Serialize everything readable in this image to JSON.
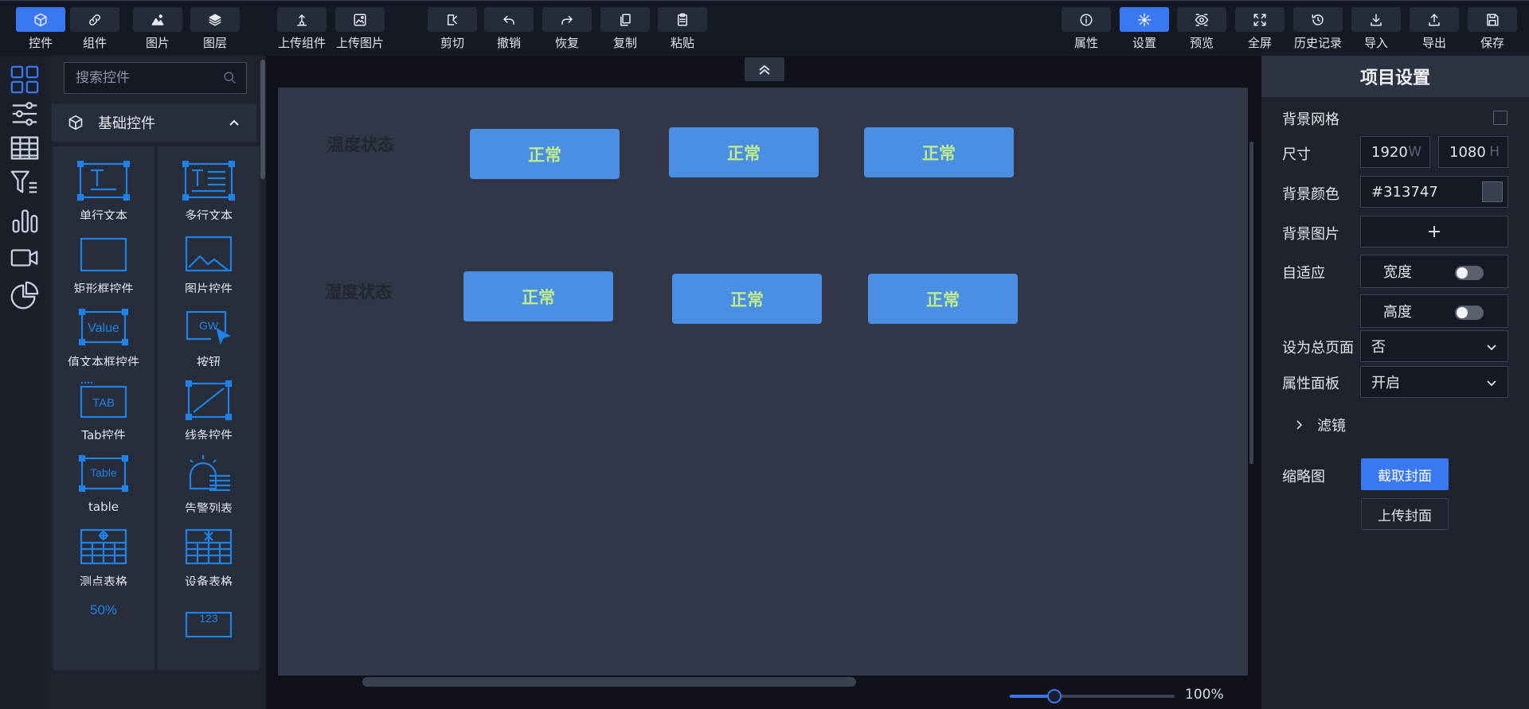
{
  "toolbar": {
    "left": [
      {
        "label": "控件",
        "icon": "cube-icon",
        "active": true
      },
      {
        "label": "组件",
        "icon": "link-icon"
      },
      {
        "label": "图片",
        "icon": "image-icon"
      },
      {
        "label": "图层",
        "icon": "layers-icon"
      }
    ],
    "upload": [
      {
        "label": "上传组件",
        "icon": "upload-component-icon"
      },
      {
        "label": "上传图片",
        "icon": "upload-image-icon"
      }
    ],
    "edit": [
      {
        "label": "剪切",
        "icon": "cut-icon"
      },
      {
        "label": "撤销",
        "icon": "undo-icon"
      },
      {
        "label": "恢复",
        "icon": "redo-icon"
      },
      {
        "label": "复制",
        "icon": "copy-icon"
      },
      {
        "label": "粘贴",
        "icon": "paste-icon"
      }
    ],
    "right": [
      {
        "label": "属性",
        "icon": "info-icon"
      },
      {
        "label": "设置",
        "icon": "gear-icon",
        "active": true
      },
      {
        "label": "预览",
        "icon": "eye-icon"
      },
      {
        "label": "全屏",
        "icon": "fullscreen-icon"
      },
      {
        "label": "历史记录",
        "icon": "history-icon"
      },
      {
        "label": "导入",
        "icon": "import-icon"
      },
      {
        "label": "导出",
        "icon": "export-icon"
      },
      {
        "label": "保存",
        "icon": "save-icon"
      }
    ]
  },
  "rail": [
    "widgets-grid-icon",
    "sliders-icon",
    "table-icon",
    "filter-list-icon",
    "bar-chart-icon",
    "video-camera-icon",
    "pie-chart-icon"
  ],
  "widgets": {
    "search_placeholder": "搜索控件",
    "group_title": "基础控件",
    "items": [
      {
        "label": "单行文本",
        "icon": "single-line-text-icon"
      },
      {
        "label": "多行文本",
        "icon": "multi-line-text-icon"
      },
      {
        "label": "矩形框控件",
        "icon": "rectangle-icon"
      },
      {
        "label": "图片控件",
        "icon": "picture-icon"
      },
      {
        "label": "值文本框控件",
        "icon": "value-textbox-icon",
        "glyph": "Value"
      },
      {
        "label": "按钮",
        "icon": "button-widget-icon",
        "glyph": "GW"
      },
      {
        "label": "Tab控件",
        "icon": "tab-widget-icon",
        "glyph": "TAB"
      },
      {
        "label": "线条控件",
        "icon": "line-widget-icon"
      },
      {
        "label": "table",
        "icon": "table-widget-icon",
        "glyph": "Table"
      },
      {
        "label": "告警列表",
        "icon": "alarm-list-icon"
      },
      {
        "label": "测点表格",
        "icon": "point-table-icon"
      },
      {
        "label": "设备表格",
        "icon": "device-table-icon"
      },
      {
        "label": "",
        "icon": "percent-widget-icon",
        "glyph": "50%"
      },
      {
        "label": "",
        "icon": "number-widget-icon",
        "glyph": "123"
      }
    ]
  },
  "canvas": {
    "rows": [
      {
        "label": "温度状态",
        "buttons": [
          "正常",
          "正常",
          "正常"
        ]
      },
      {
        "label": "湿度状态",
        "buttons": [
          "正常",
          "正常",
          "正常"
        ]
      }
    ],
    "zoom": {
      "value": 100,
      "text": "100%"
    }
  },
  "settings": {
    "title": "项目设置",
    "bg_grid_label": "背景网格",
    "size_label": "尺寸",
    "width": "1920",
    "width_unit": "W",
    "height": "1080",
    "height_unit": "H",
    "bg_color_label": "背景颜色",
    "bg_color": "#313747",
    "bg_image_label": "背景图片",
    "bg_image_add": "+",
    "adaptive_label": "自适应",
    "adaptive_width": "宽度",
    "adaptive_height": "高度",
    "home_page_label": "设为总页面",
    "home_page_value": "否",
    "prop_panel_label": "属性面板",
    "prop_panel_value": "开启",
    "filter_label": "滤镜",
    "thumbnail_label": "缩略图",
    "capture_cover": "截取封面",
    "upload_cover": "上传封面"
  },
  "colors": {
    "accent": "#3a78f2",
    "status_button": "#4a8fe4",
    "status_text": "#bfeb8a",
    "board": "#313747"
  }
}
